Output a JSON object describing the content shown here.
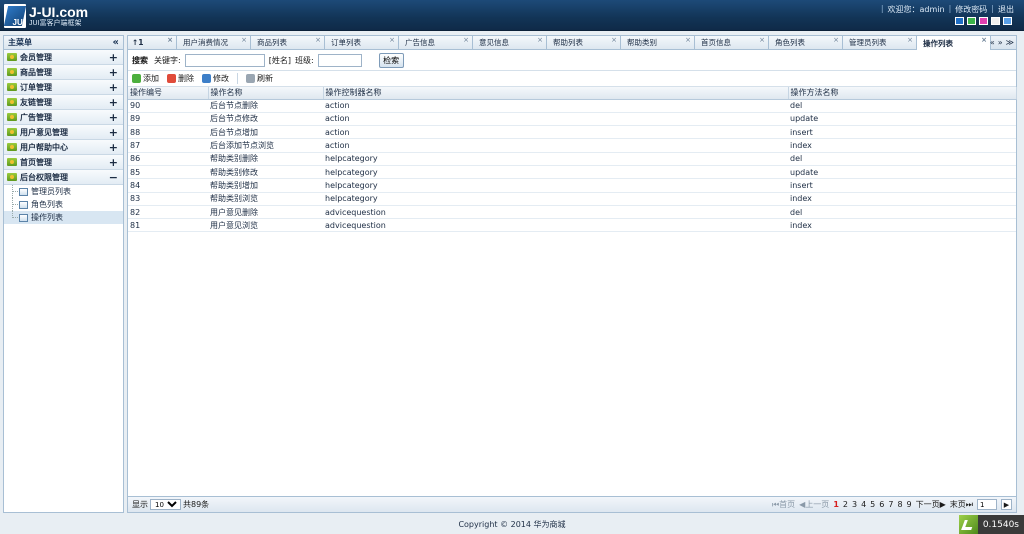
{
  "header": {
    "logo_big": "J-UI.com",
    "logo_small": "JUI富客户端框架",
    "logo_mark": "JUI",
    "welcome": "欢迎您：",
    "user": "admin",
    "change_password": "修改密码",
    "logout": "退出",
    "sep": "|",
    "themes": [
      "#1f6fc6",
      "#3bb34a",
      "#e040b0",
      "#f0f0f0",
      "#5aa0e8"
    ]
  },
  "sidebar": {
    "title": "主菜单",
    "collapse": "«",
    "menus": [
      {
        "label": "会员管理",
        "toggle": "+"
      },
      {
        "label": "商品管理",
        "toggle": "+"
      },
      {
        "label": "订单管理",
        "toggle": "+"
      },
      {
        "label": "友链管理",
        "toggle": "+"
      },
      {
        "label": "广告管理",
        "toggle": "+"
      },
      {
        "label": "用户意见管理",
        "toggle": "+"
      },
      {
        "label": "用户帮助中心",
        "toggle": "+"
      },
      {
        "label": "首页管理",
        "toggle": "+"
      },
      {
        "label": "后台权限管理",
        "toggle": "−"
      }
    ],
    "subitems": [
      "管理员列表",
      "角色列表",
      "操作列表"
    ]
  },
  "tabs": {
    "home": "↑",
    "home_num": "1",
    "items": [
      "用户消费情况",
      "商品列表",
      "订单列表",
      "广告信息",
      "意见信息",
      "帮助列表",
      "帮助类别",
      "首页信息",
      "角色列表",
      "管理员列表",
      "操作列表"
    ],
    "close": "×",
    "ctl_left": "«",
    "ctl_right": "»",
    "ctl_menu": "≫"
  },
  "search": {
    "title": "搜索",
    "keyword_label": "关键字:",
    "keyword_value": "",
    "name_label": "[姓名]",
    "class_label": "班级:",
    "class_value": "",
    "button": "检索"
  },
  "toolbar": {
    "add": "添加",
    "delete": "删除",
    "edit": "修改",
    "refresh": "刷新"
  },
  "grid": {
    "columns": [
      "操作编号",
      "操作名称",
      "操作控制器名称",
      "操作方法名称"
    ],
    "rows": [
      [
        "90",
        "后台节点删除",
        "action",
        "del"
      ],
      [
        "89",
        "后台节点修改",
        "action",
        "update"
      ],
      [
        "88",
        "后台节点增加",
        "action",
        "insert"
      ],
      [
        "87",
        "后台添加节点浏览",
        "action",
        "index"
      ],
      [
        "86",
        "帮助类别删除",
        "helpcategory",
        "del"
      ],
      [
        "85",
        "帮助类别修改",
        "helpcategory",
        "update"
      ],
      [
        "84",
        "帮助类别增加",
        "helpcategory",
        "insert"
      ],
      [
        "83",
        "帮助类别浏览",
        "helpcategory",
        "index"
      ],
      [
        "82",
        "用户意见删除",
        "advicequestion",
        "del"
      ],
      [
        "81",
        "用户意见浏览",
        "advicequestion",
        "index"
      ]
    ]
  },
  "pager": {
    "show": "显示",
    "page_size": "10",
    "total": "共89条",
    "first": "首页",
    "prev": "上一页",
    "pages": [
      "1",
      "2",
      "3",
      "4",
      "5",
      "6",
      "7",
      "8",
      "9"
    ],
    "current": "1",
    "next": "下一页",
    "last": "末页",
    "goto_value": "1"
  },
  "footer": {
    "copyright": "Copyright © 2014 华为商城"
  },
  "timer": {
    "value": "0.1540s"
  }
}
